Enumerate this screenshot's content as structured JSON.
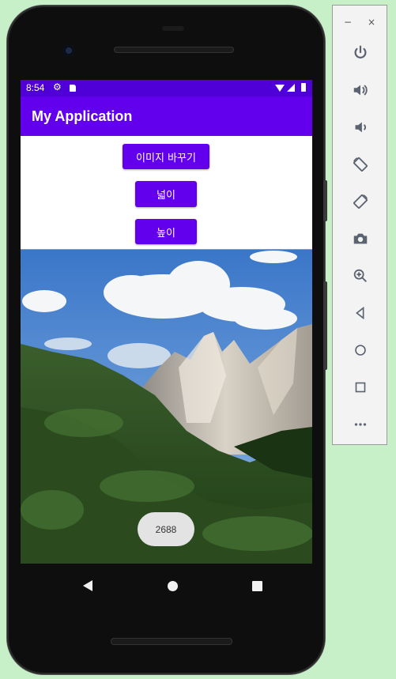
{
  "status_bar": {
    "time": "8:54"
  },
  "app_bar": {
    "title": "My Application"
  },
  "buttons": {
    "change_image": "이미지 바꾸기",
    "width": "넓이",
    "height": "높이"
  },
  "toast": {
    "text": "2688"
  },
  "emulator_toolbar": {
    "minimize_label": "−",
    "close_label": "×",
    "tools": [
      "power-icon",
      "volume-up-icon",
      "volume-down-icon",
      "rotate-left-icon",
      "rotate-right-icon",
      "camera-icon",
      "zoom-icon",
      "back-icon",
      "home-icon",
      "overview-icon",
      "more-icon"
    ]
  },
  "colors": {
    "primary": "#6200ee",
    "status_bar": "#4f00d6",
    "toolbar_icon": "#5b6270"
  }
}
